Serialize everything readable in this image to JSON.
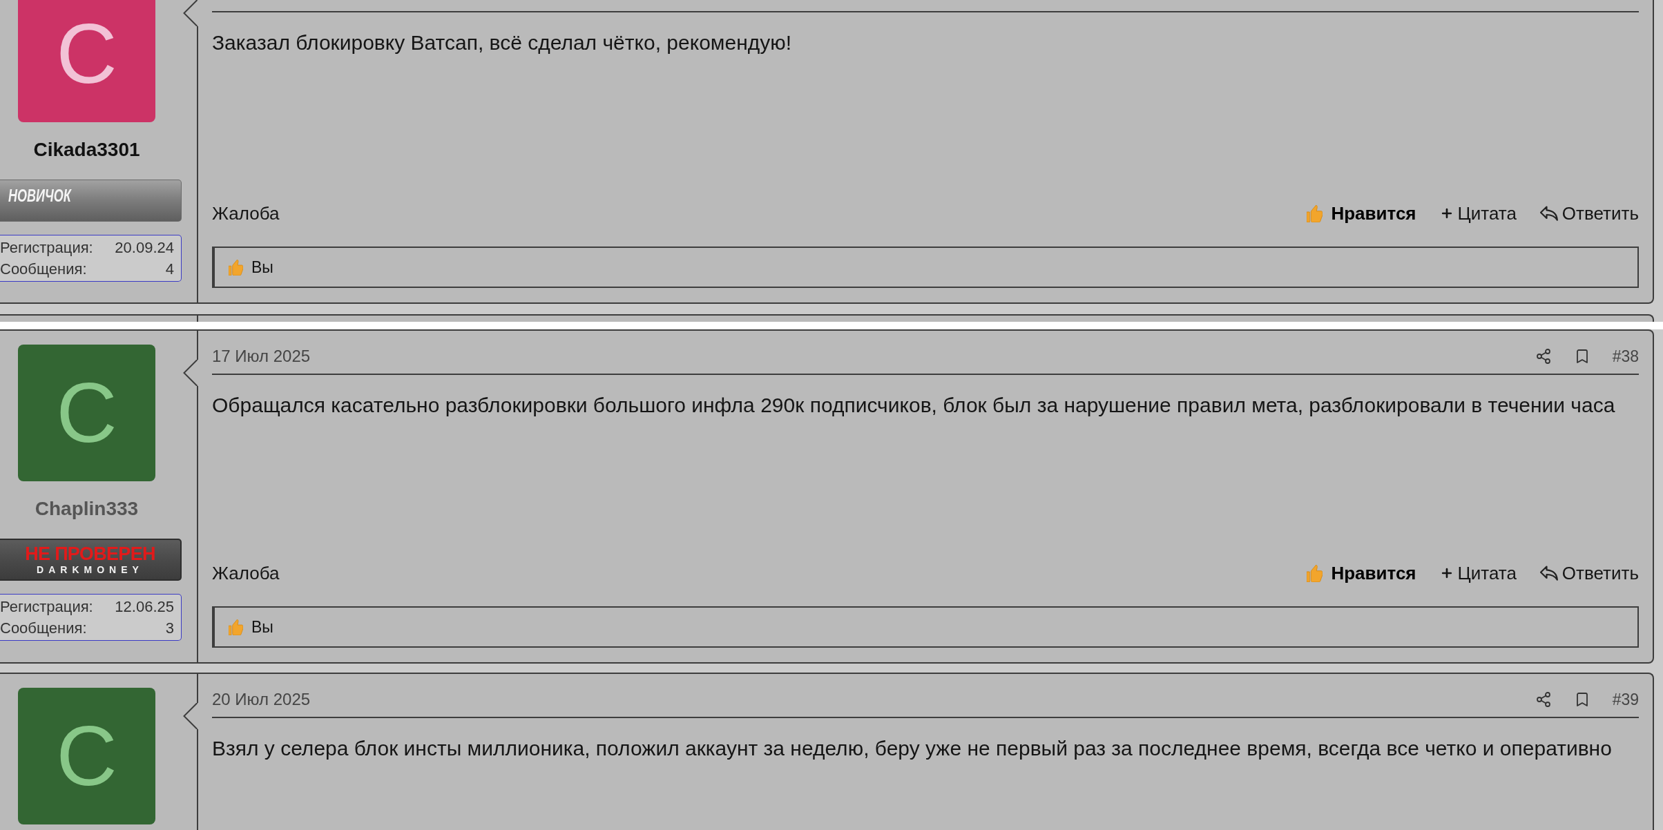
{
  "posts": [
    {
      "author": {
        "name": "Cikada3301",
        "color": "#111111",
        "avatar": {
          "color": "#cc3366",
          "letter": {
            "text": "C",
            "color": "#f2c2d6"
          }
        },
        "banner": {
          "kind": "novice",
          "title": "НОВИЧОК"
        },
        "stats": [
          {
            "label": "Регистрация:",
            "value": "20.09.24"
          },
          {
            "label": "Сообщения:",
            "value": "4"
          }
        ]
      },
      "message": "Заказал блокировку Ватсап, всё сделал чётко, рекомендую!",
      "actions": {
        "report": "Жалоба",
        "like": "Нравится",
        "liked": true,
        "quote": "Цитата",
        "reply": "Ответить"
      },
      "reactions": {
        "users": "Вы"
      }
    },
    {
      "author": {
        "name": "Chaplin333",
        "color": "#555555",
        "avatar": {
          "color": "#336633",
          "letter": {
            "text": "C",
            "color": "#88c788"
          }
        },
        "banner": {
          "kind": "unverified",
          "title": "НЕ ПРОВЕРЕН",
          "subtitle": "DARKMONEY"
        },
        "stats": [
          {
            "label": "Регистрация:",
            "value": "12.06.25"
          },
          {
            "label": "Сообщения:",
            "value": "3"
          }
        ]
      },
      "date": "17 Июл 2025",
      "number": "#38",
      "message": "Обращался касательно разблокировки большого инфла 290к подписчиков, блок был за нарушение правил мета, разблокировали в течении часа",
      "actions": {
        "report": "Жалоба",
        "like": "Нравится",
        "liked": true,
        "quote": "Цитата",
        "reply": "Ответить"
      },
      "reactions": {
        "users": "Вы"
      }
    },
    {
      "author": {
        "avatar": {
          "color": "#336633",
          "letter": {
            "text": "C",
            "color": "#88c788"
          }
        }
      },
      "date": "20 Июл 2025",
      "number": "#39",
      "message": "Взял у селера блок инсты миллионика, положил аккаунт за неделю, беру уже не первый раз за последнее время, всегда все четко и оперативно"
    }
  ]
}
